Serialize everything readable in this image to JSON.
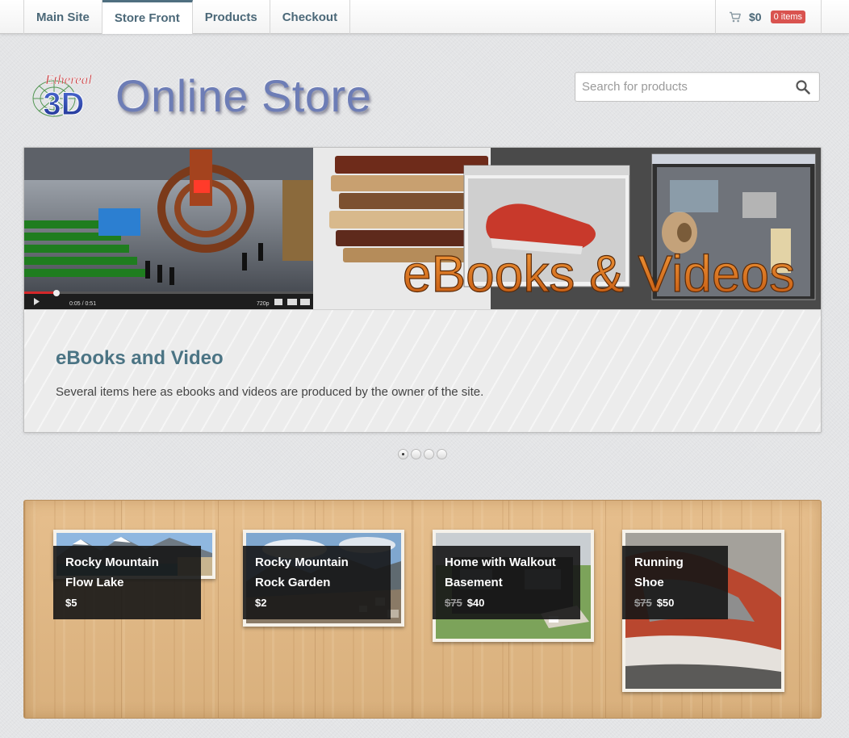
{
  "nav": {
    "tabs": [
      {
        "label": "Main Site",
        "active": false
      },
      {
        "label": "Store Front",
        "active": true
      },
      {
        "label": "Products",
        "active": false
      },
      {
        "label": "Checkout",
        "active": false
      }
    ],
    "cart": {
      "icon": "cart-icon",
      "total": "$0",
      "badge": "0 items"
    }
  },
  "header": {
    "store_title": "Online Store",
    "search_placeholder": "Search for products",
    "search_icon": "search-icon"
  },
  "slider": {
    "caption_title": "eBooks and Video",
    "caption_text": "Several items here as ebooks and videos are produced by the owner of the site.",
    "banner": {
      "text": "eBooks & Videos",
      "video_time": "0:05 / 0:51",
      "video_quality": "720p"
    },
    "active_dot": 0
  },
  "products": [
    {
      "name": "Rocky Mountain Flow Lake",
      "old_price": "",
      "price": "$5"
    },
    {
      "name": "Rocky Mountain Rock Garden",
      "old_price": "",
      "price": "$2"
    },
    {
      "name": "Home with Walkout Basement",
      "old_price": "$75",
      "price": "$40"
    },
    {
      "name": "Running Shoe",
      "old_price": "$75",
      "price": "$50"
    }
  ],
  "colors": {
    "nav_text": "#4b6878",
    "badge": "#d9534f",
    "title": "#6d7db6",
    "caption_title": "#4b7484",
    "banner_text": "#e07a1c"
  }
}
